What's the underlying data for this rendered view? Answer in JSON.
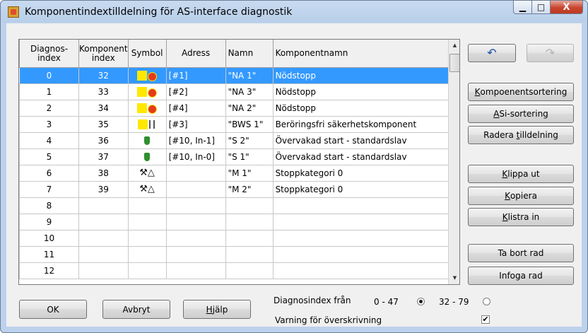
{
  "window": {
    "title": "Komponentindextilldelning för AS-interface diagnostik",
    "minimize_glyph": "▁",
    "maximize_glyph": "□",
    "close_glyph": "X"
  },
  "grid": {
    "headers": {
      "diag_line1": "Diagnos-",
      "diag_line2": "index",
      "comp_line1": "Komponent",
      "comp_line2": "index",
      "symbol": "Symbol",
      "adress": "Adress",
      "namn": "Namn",
      "komponentnamn": "Komponentnamn"
    },
    "rows": [
      {
        "diag": "0",
        "comp": "32",
        "symbol": "estop-symbol",
        "adress": "[#1]",
        "namn": "\"NA 1\"",
        "komponentnamn": "Nödstopp",
        "selected": true
      },
      {
        "diag": "1",
        "comp": "33",
        "symbol": "estop-symbol",
        "adress": "[#2]",
        "namn": "\"NA 3\"",
        "komponentnamn": "Nödstopp"
      },
      {
        "diag": "2",
        "comp": "34",
        "symbol": "estop-symbol",
        "adress": "[#4]",
        "namn": "\"NA 2\"",
        "komponentnamn": "Nödstopp"
      },
      {
        "diag": "3",
        "comp": "35",
        "symbol": "light-curtain-symbol",
        "adress": "[#3]",
        "namn": "\"BWS 1\"",
        "komponentnamn": "Beröringsfri säkerhetskomponent"
      },
      {
        "diag": "4",
        "comp": "36",
        "symbol": "start-symbol",
        "adress": "[#10, In-1]",
        "namn": "\"S 2\"",
        "komponentnamn": "Övervakad start - standardslav"
      },
      {
        "diag": "5",
        "comp": "37",
        "symbol": "start-symbol",
        "adress": "[#10, In-0]",
        "namn": "\"S 1\"",
        "komponentnamn": "Övervakad start - standardslav"
      },
      {
        "diag": "6",
        "comp": "38",
        "symbol": "stop-category-symbol",
        "adress": "",
        "namn": "\"M 1\"",
        "komponentnamn": "Stoppkategori 0"
      },
      {
        "diag": "7",
        "comp": "39",
        "symbol": "stop-category-symbol",
        "adress": "",
        "namn": "\"M 2\"",
        "komponentnamn": "Stoppkategori 0"
      },
      {
        "diag": "8",
        "comp": "",
        "symbol": "",
        "adress": "",
        "namn": "",
        "komponentnamn": ""
      },
      {
        "diag": "9",
        "comp": "",
        "symbol": "",
        "adress": "",
        "namn": "",
        "komponentnamn": ""
      },
      {
        "diag": "10",
        "comp": "",
        "symbol": "",
        "adress": "",
        "namn": "",
        "komponentnamn": ""
      },
      {
        "diag": "11",
        "comp": "",
        "symbol": "",
        "adress": "",
        "namn": "",
        "komponentnamn": ""
      },
      {
        "diag": "12",
        "comp": "",
        "symbol": "",
        "adress": "",
        "namn": "",
        "komponentnamn": ""
      }
    ],
    "stop_category_glyph": "⚒△"
  },
  "side_buttons": {
    "undo_glyph": "↶",
    "redo_glyph": "↷",
    "komponentsortering": {
      "pre": "",
      "u": "K",
      "post": "ompoenentsortering"
    },
    "asi_sortering": {
      "pre": "",
      "u": "A",
      "post": "Si-sortering"
    },
    "radera": {
      "pre": "Radera ",
      "u": "t",
      "post": "illdelning"
    },
    "klippa": {
      "pre": "",
      "u": "K",
      "post": "lippa ut"
    },
    "kopiera": {
      "pre": "",
      "u": "K",
      "post": "opiera"
    },
    "klistra": {
      "pre": "",
      "u": "K",
      "post": "listra in"
    },
    "ta_bort": "Ta bort rad",
    "infoga": "Infoga rad"
  },
  "bottom": {
    "ok": "OK",
    "avbryt": "Avbryt",
    "hjalp": {
      "pre": "",
      "u": "H",
      "post": "jälp"
    },
    "diag_from_label": "Diagnosindex från",
    "range1": "0 - 47",
    "range2": "32 - 79",
    "overwrite_label": "Varning för överskrivning",
    "overwrite_checked": true,
    "selected_range": "0 - 47"
  }
}
